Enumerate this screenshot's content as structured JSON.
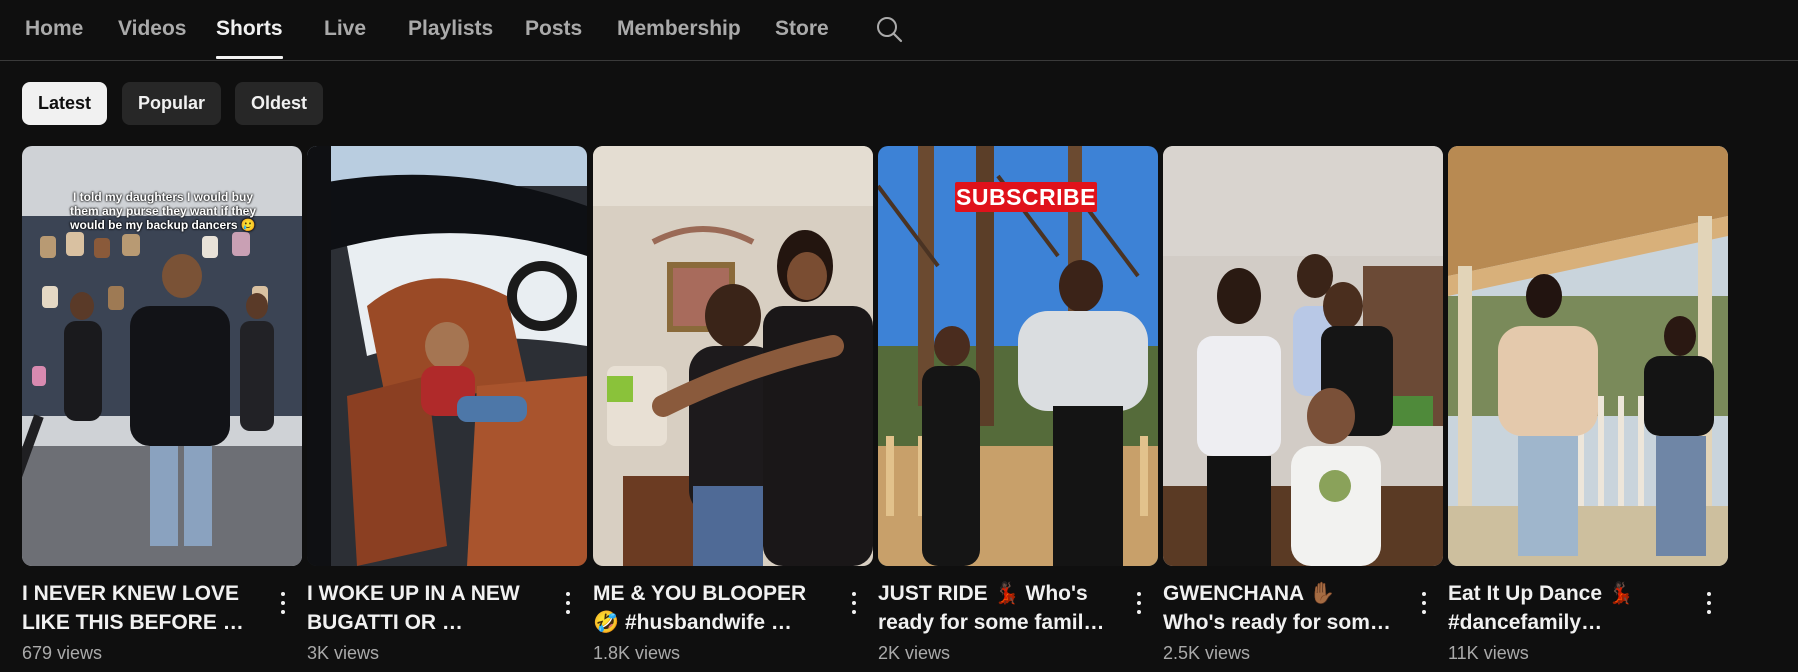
{
  "tabs": [
    {
      "label": "Home"
    },
    {
      "label": "Videos"
    },
    {
      "label": "Shorts",
      "active": true
    },
    {
      "label": "Live"
    },
    {
      "label": "Playlists"
    },
    {
      "label": "Posts"
    },
    {
      "label": "Membership"
    },
    {
      "label": "Store"
    }
  ],
  "search": {
    "icon": "search-icon"
  },
  "filters": [
    {
      "label": "Latest",
      "active": true
    },
    {
      "label": "Popular"
    },
    {
      "label": "Oldest"
    }
  ],
  "shorts": [
    {
      "title": "I NEVER KNEW LOVE LIKE THIS BEFORE 🗣️🔥",
      "views": "679 views",
      "overlay_text": "I told my daughters I would buy them any purse they want if they would be my backup dancers 🥲"
    },
    {
      "title": "I WOKE UP IN A NEW BUGATTI OR …",
      "views": "3K views"
    },
    {
      "title": "ME & YOU BLOOPER 🤣 #husbandwife …",
      "views": "1.8K views"
    },
    {
      "title": "JUST RIDE 💃🏿 Who's ready for some family …",
      "views": "2K views",
      "overlay_text": "SUBSCRIBE"
    },
    {
      "title": "GWENCHANA ✋🏾 Who's ready for some summ…",
      "views": "2.5K views"
    },
    {
      "title": "Eat It Up Dance 💃🏿 #dancefamily #sibling…",
      "views": "11K views"
    }
  ],
  "colors": {
    "background": "#0f0f0f",
    "text_primary": "#f1f1f1",
    "text_secondary": "#aaaaaa",
    "chip_bg": "#272727",
    "chip_active_bg": "#f1f1f1",
    "subscribe_red": "#e0121b"
  }
}
